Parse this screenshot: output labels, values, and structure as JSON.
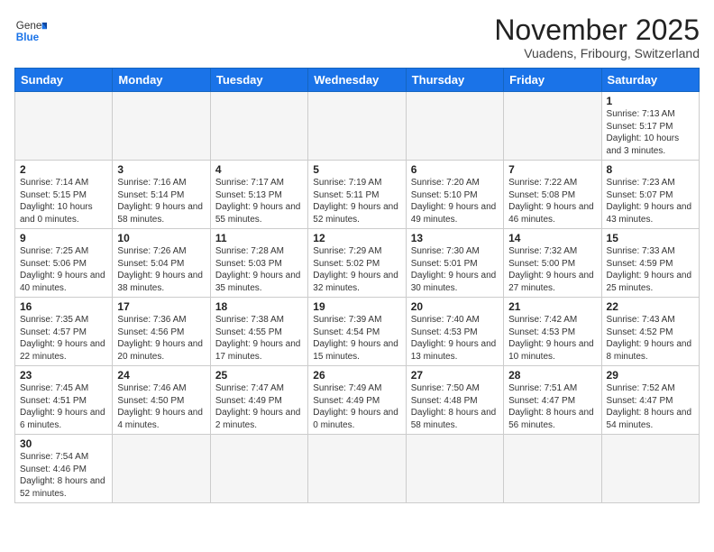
{
  "header": {
    "logo_general": "General",
    "logo_blue": "Blue",
    "month_year": "November 2025",
    "location": "Vuadens, Fribourg, Switzerland"
  },
  "weekdays": [
    "Sunday",
    "Monday",
    "Tuesday",
    "Wednesday",
    "Thursday",
    "Friday",
    "Saturday"
  ],
  "weeks": [
    [
      {
        "day": "",
        "info": ""
      },
      {
        "day": "",
        "info": ""
      },
      {
        "day": "",
        "info": ""
      },
      {
        "day": "",
        "info": ""
      },
      {
        "day": "",
        "info": ""
      },
      {
        "day": "",
        "info": ""
      },
      {
        "day": "1",
        "info": "Sunrise: 7:13 AM\nSunset: 5:17 PM\nDaylight: 10 hours and 3 minutes."
      }
    ],
    [
      {
        "day": "2",
        "info": "Sunrise: 7:14 AM\nSunset: 5:15 PM\nDaylight: 10 hours and 0 minutes."
      },
      {
        "day": "3",
        "info": "Sunrise: 7:16 AM\nSunset: 5:14 PM\nDaylight: 9 hours and 58 minutes."
      },
      {
        "day": "4",
        "info": "Sunrise: 7:17 AM\nSunset: 5:13 PM\nDaylight: 9 hours and 55 minutes."
      },
      {
        "day": "5",
        "info": "Sunrise: 7:19 AM\nSunset: 5:11 PM\nDaylight: 9 hours and 52 minutes."
      },
      {
        "day": "6",
        "info": "Sunrise: 7:20 AM\nSunset: 5:10 PM\nDaylight: 9 hours and 49 minutes."
      },
      {
        "day": "7",
        "info": "Sunrise: 7:22 AM\nSunset: 5:08 PM\nDaylight: 9 hours and 46 minutes."
      },
      {
        "day": "8",
        "info": "Sunrise: 7:23 AM\nSunset: 5:07 PM\nDaylight: 9 hours and 43 minutes."
      }
    ],
    [
      {
        "day": "9",
        "info": "Sunrise: 7:25 AM\nSunset: 5:06 PM\nDaylight: 9 hours and 40 minutes."
      },
      {
        "day": "10",
        "info": "Sunrise: 7:26 AM\nSunset: 5:04 PM\nDaylight: 9 hours and 38 minutes."
      },
      {
        "day": "11",
        "info": "Sunrise: 7:28 AM\nSunset: 5:03 PM\nDaylight: 9 hours and 35 minutes."
      },
      {
        "day": "12",
        "info": "Sunrise: 7:29 AM\nSunset: 5:02 PM\nDaylight: 9 hours and 32 minutes."
      },
      {
        "day": "13",
        "info": "Sunrise: 7:30 AM\nSunset: 5:01 PM\nDaylight: 9 hours and 30 minutes."
      },
      {
        "day": "14",
        "info": "Sunrise: 7:32 AM\nSunset: 5:00 PM\nDaylight: 9 hours and 27 minutes."
      },
      {
        "day": "15",
        "info": "Sunrise: 7:33 AM\nSunset: 4:59 PM\nDaylight: 9 hours and 25 minutes."
      }
    ],
    [
      {
        "day": "16",
        "info": "Sunrise: 7:35 AM\nSunset: 4:57 PM\nDaylight: 9 hours and 22 minutes."
      },
      {
        "day": "17",
        "info": "Sunrise: 7:36 AM\nSunset: 4:56 PM\nDaylight: 9 hours and 20 minutes."
      },
      {
        "day": "18",
        "info": "Sunrise: 7:38 AM\nSunset: 4:55 PM\nDaylight: 9 hours and 17 minutes."
      },
      {
        "day": "19",
        "info": "Sunrise: 7:39 AM\nSunset: 4:54 PM\nDaylight: 9 hours and 15 minutes."
      },
      {
        "day": "20",
        "info": "Sunrise: 7:40 AM\nSunset: 4:53 PM\nDaylight: 9 hours and 13 minutes."
      },
      {
        "day": "21",
        "info": "Sunrise: 7:42 AM\nSunset: 4:53 PM\nDaylight: 9 hours and 10 minutes."
      },
      {
        "day": "22",
        "info": "Sunrise: 7:43 AM\nSunset: 4:52 PM\nDaylight: 9 hours and 8 minutes."
      }
    ],
    [
      {
        "day": "23",
        "info": "Sunrise: 7:45 AM\nSunset: 4:51 PM\nDaylight: 9 hours and 6 minutes."
      },
      {
        "day": "24",
        "info": "Sunrise: 7:46 AM\nSunset: 4:50 PM\nDaylight: 9 hours and 4 minutes."
      },
      {
        "day": "25",
        "info": "Sunrise: 7:47 AM\nSunset: 4:49 PM\nDaylight: 9 hours and 2 minutes."
      },
      {
        "day": "26",
        "info": "Sunrise: 7:49 AM\nSunset: 4:49 PM\nDaylight: 9 hours and 0 minutes."
      },
      {
        "day": "27",
        "info": "Sunrise: 7:50 AM\nSunset: 4:48 PM\nDaylight: 8 hours and 58 minutes."
      },
      {
        "day": "28",
        "info": "Sunrise: 7:51 AM\nSunset: 4:47 PM\nDaylight: 8 hours and 56 minutes."
      },
      {
        "day": "29",
        "info": "Sunrise: 7:52 AM\nSunset: 4:47 PM\nDaylight: 8 hours and 54 minutes."
      }
    ],
    [
      {
        "day": "30",
        "info": "Sunrise: 7:54 AM\nSunset: 4:46 PM\nDaylight: 8 hours and 52 minutes."
      },
      {
        "day": "",
        "info": ""
      },
      {
        "day": "",
        "info": ""
      },
      {
        "day": "",
        "info": ""
      },
      {
        "day": "",
        "info": ""
      },
      {
        "day": "",
        "info": ""
      },
      {
        "day": "",
        "info": ""
      }
    ]
  ]
}
